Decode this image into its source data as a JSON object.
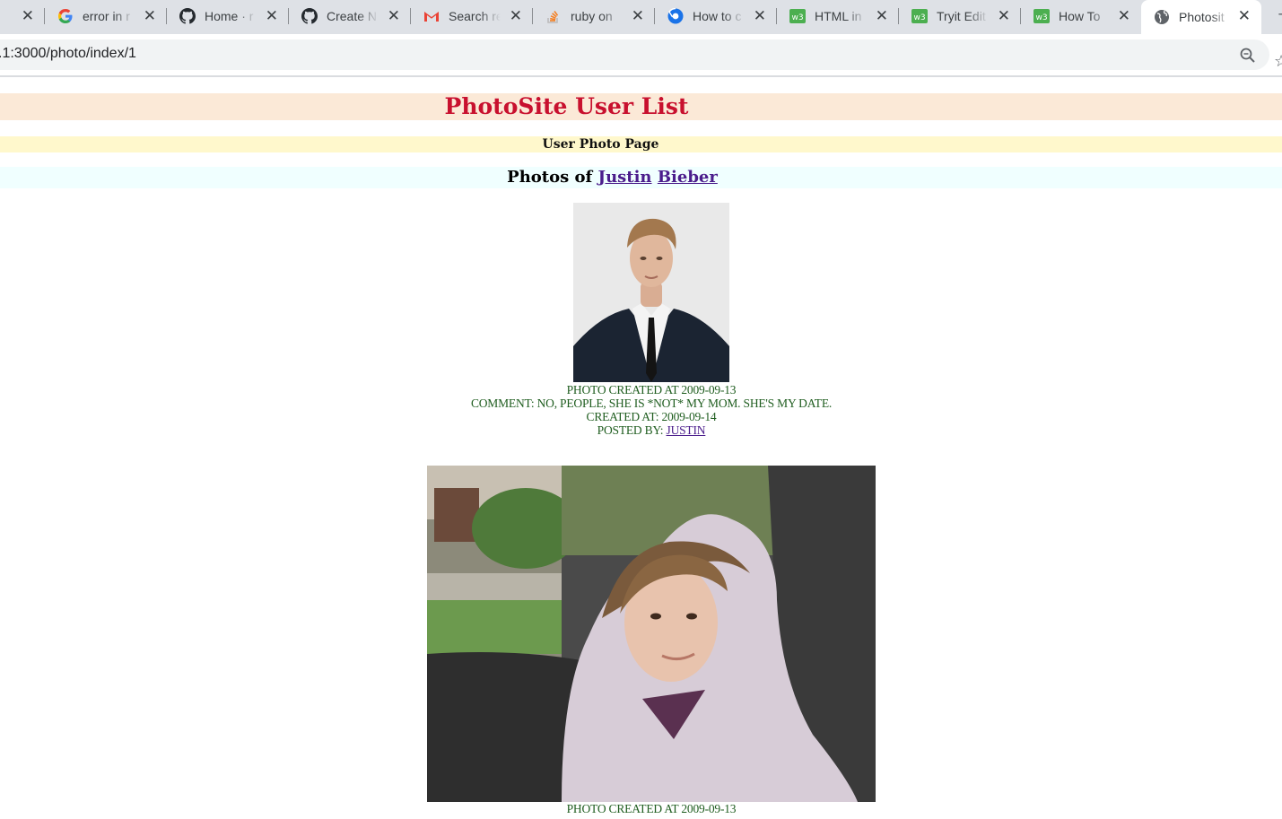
{
  "browser": {
    "tabs": [
      {
        "title": "",
        "favicon": "blank-icon"
      },
      {
        "title": "error in r",
        "favicon": "google-icon"
      },
      {
        "title": "Home · r",
        "favicon": "github-icon"
      },
      {
        "title": "Create N",
        "favicon": "github-icon"
      },
      {
        "title": "Search re",
        "favicon": "gmail-icon"
      },
      {
        "title": "ruby on",
        "favicon": "stackoverflow-icon"
      },
      {
        "title": "How to c",
        "favicon": "chromium-icon"
      },
      {
        "title": "HTML in",
        "favicon": "w3schools-icon"
      },
      {
        "title": "Tryit Edit",
        "favicon": "w3schools-icon"
      },
      {
        "title": "How To",
        "favicon": "w3schools-icon"
      },
      {
        "title": "Photosit",
        "favicon": "globe-icon",
        "active": true
      }
    ],
    "close_glyph": "✕",
    "url": ".1:3000/photo/index/1"
  },
  "page": {
    "title": "PhotoSite User List",
    "subtitle": "User Photo Page",
    "heading_prefix": "Photos of",
    "first_name": "Justin",
    "last_name": "Bieber",
    "photos": [
      {
        "created": "Photo created at 2009-09-13",
        "comment": "Comment: No, people, she is *not* my mom. She's my date.",
        "comment_created": "Created at: 2009-09-14",
        "posted_by_label": "Posted by:",
        "posted_by": "Justin"
      },
      {
        "created": "Photo created at 2009-09-13"
      }
    ]
  },
  "colors": {
    "title_red": "#c8102e",
    "title_band": "#fbe9d7",
    "subtitle_band": "#fff8cc",
    "heading_band": "#f0ffff",
    "caption_green": "#1f5d1f",
    "link_purple": "#4b1d8c"
  }
}
